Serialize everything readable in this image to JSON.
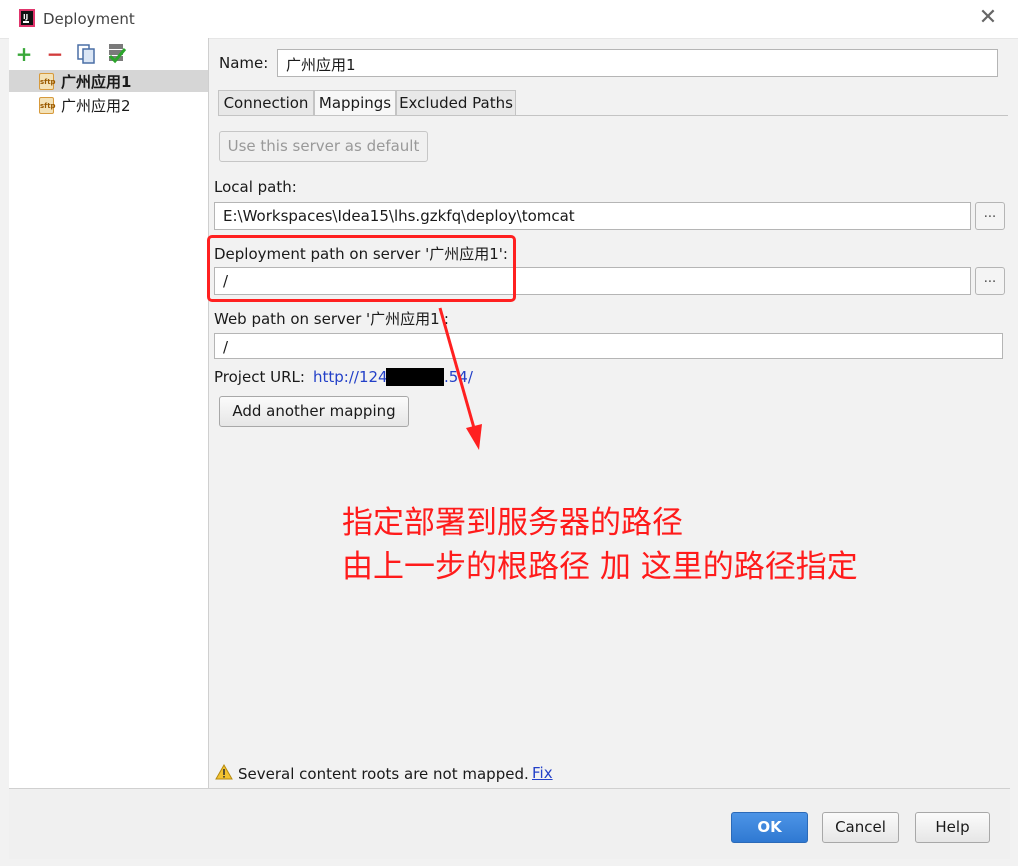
{
  "window": {
    "title": "Deployment"
  },
  "toolbar": {
    "add_icon": "plus-icon",
    "remove_icon": "minus-icon",
    "copy_icon": "copy-icon",
    "default_icon": "check-server-icon"
  },
  "servers": [
    {
      "label": "广州应用1",
      "selected": true,
      "icon": "sftp-icon"
    },
    {
      "label": "广州应用2",
      "selected": false,
      "icon": "sftp-icon"
    }
  ],
  "form": {
    "name_label": "Name:",
    "name_value": "广州应用1"
  },
  "tabs": [
    {
      "label": "Connection",
      "active": false
    },
    {
      "label": "Mappings",
      "active": true
    },
    {
      "label": "Excluded Paths",
      "active": false
    }
  ],
  "mappings": {
    "use_default_button": "Use this server as default",
    "local_path_label": "Local path:",
    "local_path_value": "E:\\Workspaces\\Idea15\\lhs.gzkfq\\deploy\\tomcat",
    "deploy_path_label": "Deployment path on server '广州应用1':",
    "deploy_path_value": "/",
    "web_path_label": "Web path on server '广州应用1':",
    "web_path_value": "/",
    "project_url_label": "Project URL:",
    "project_url_prefix": "http://124",
    "project_url_suffix": ".54/",
    "browse_label": "...",
    "add_mapping_button": "Add another mapping"
  },
  "warning": {
    "text": "Several content roots are not mapped.",
    "fix_link": "Fix"
  },
  "buttons": {
    "ok": "OK",
    "cancel": "Cancel",
    "help": "Help"
  },
  "annotation": {
    "line1": "指定部署到服务器的路径",
    "line2": "由上一步的根路径 加 这里的路径指定",
    "color": "#ff1b1b"
  }
}
